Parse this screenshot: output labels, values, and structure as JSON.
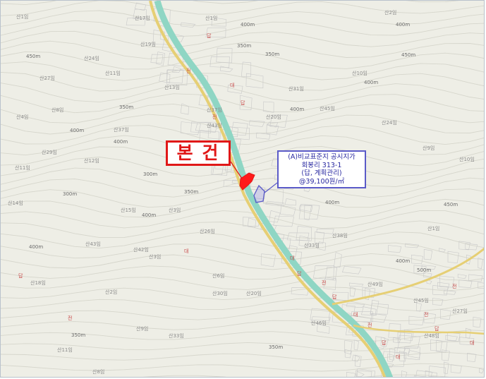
{
  "subject": {
    "label": "본 건"
  },
  "comparison": {
    "line1": "(A)비교표준지 공시지가",
    "line2": "회봉리 313-1",
    "line3": "(답, 계획관리)",
    "line4": "@39,100원/㎡"
  },
  "map": {
    "colors": {
      "background": "#eeeee6",
      "river": "#8fd6c4",
      "road": "#e6cf74",
      "subject_parcel": "#ff1a1a",
      "callout": "#5a5ac8",
      "subject_border": "#e01818"
    },
    "contour_labels": [
      {
        "text": "400m"
      },
      {
        "text": "350m"
      },
      {
        "text": "450m"
      },
      {
        "text": "400m"
      },
      {
        "text": "450m"
      },
      {
        "text": "400m"
      },
      {
        "text": "400m"
      },
      {
        "text": "350m"
      },
      {
        "text": "350m"
      },
      {
        "text": "400m"
      },
      {
        "text": "400m"
      },
      {
        "text": "300m"
      },
      {
        "text": "350m"
      },
      {
        "text": "300m"
      },
      {
        "text": "400m"
      },
      {
        "text": "400m"
      },
      {
        "text": "450m"
      },
      {
        "text": "500m"
      },
      {
        "text": "400m"
      },
      {
        "text": "350m"
      },
      {
        "text": "350m"
      },
      {
        "text": "400m"
      }
    ],
    "parcel_labels": [
      {
        "text": "산1임"
      },
      {
        "text": "산17임"
      },
      {
        "text": "산1임"
      },
      {
        "text": "산2임"
      },
      {
        "text": "산19임"
      },
      {
        "text": "산24임"
      },
      {
        "text": "산27임"
      },
      {
        "text": "산11임"
      },
      {
        "text": "산13임"
      },
      {
        "text": "산10임"
      },
      {
        "text": "산31임"
      },
      {
        "text": "산37임"
      },
      {
        "text": "산45임"
      },
      {
        "text": "산4임"
      },
      {
        "text": "산8임"
      },
      {
        "text": "산20임"
      },
      {
        "text": "산24임"
      },
      {
        "text": "산37임"
      },
      {
        "text": "산43임"
      },
      {
        "text": "산12임"
      },
      {
        "text": "산11임"
      },
      {
        "text": "산29임"
      },
      {
        "text": "산9임"
      },
      {
        "text": "산10임"
      },
      {
        "text": "산15임"
      },
      {
        "text": "산3임"
      },
      {
        "text": "산38임"
      },
      {
        "text": "산33임"
      },
      {
        "text": "산26임"
      },
      {
        "text": "산42임"
      },
      {
        "text": "산43임"
      },
      {
        "text": "산1임"
      },
      {
        "text": "산14임"
      },
      {
        "text": "산18임"
      },
      {
        "text": "산2임"
      },
      {
        "text": "산3임"
      },
      {
        "text": "산6임"
      },
      {
        "text": "산45임"
      },
      {
        "text": "산49임"
      },
      {
        "text": "산20임"
      },
      {
        "text": "산30임"
      },
      {
        "text": "산33임"
      },
      {
        "text": "산9임"
      },
      {
        "text": "산11임"
      },
      {
        "text": "산8임"
      },
      {
        "text": "산46임"
      },
      {
        "text": "산48임"
      },
      {
        "text": "산27임"
      }
    ],
    "red_labels": [
      {
        "text": "답"
      },
      {
        "text": "전"
      },
      {
        "text": "대"
      },
      {
        "text": "답"
      },
      {
        "text": "전"
      },
      {
        "text": "대"
      },
      {
        "text": "답"
      },
      {
        "text": "전"
      },
      {
        "text": "답"
      },
      {
        "text": "대"
      },
      {
        "text": "전"
      },
      {
        "text": "답"
      },
      {
        "text": "대"
      },
      {
        "text": "전"
      },
      {
        "text": "답"
      },
      {
        "text": "전"
      },
      {
        "text": "대"
      },
      {
        "text": "답"
      },
      {
        "text": "전"
      },
      {
        "text": "대"
      }
    ]
  }
}
